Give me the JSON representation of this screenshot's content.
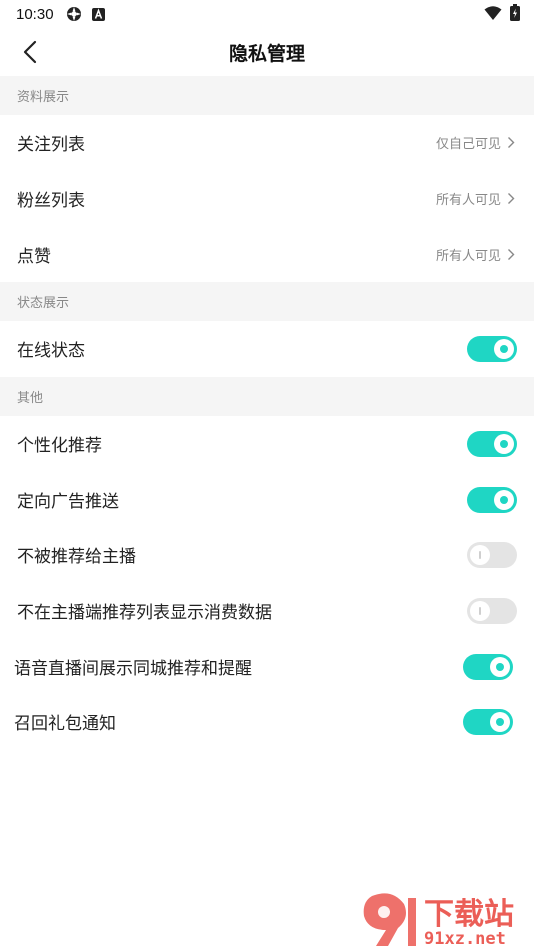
{
  "status_bar": {
    "time": "10:30"
  },
  "nav": {
    "title": "隐私管理"
  },
  "sections": [
    {
      "title": "资料展示"
    },
    {
      "title": "状态展示"
    },
    {
      "title": "其他"
    }
  ],
  "rows": {
    "follow_list": {
      "label": "关注列表",
      "value": "仅自己可见"
    },
    "fans_list": {
      "label": "粉丝列表",
      "value": "所有人可见"
    },
    "likes": {
      "label": "点赞",
      "value": "所有人可见"
    },
    "online_status": {
      "label": "在线状态",
      "enabled": true
    },
    "personalized_rec": {
      "label": "个性化推荐",
      "enabled": true
    },
    "targeted_ads": {
      "label": "定向广告推送",
      "enabled": true
    },
    "not_recommended_to_host": {
      "label": "不被推荐给主播",
      "enabled": false
    },
    "hide_consumption": {
      "label": "不在主播端推荐列表显示消费数据",
      "enabled": false
    },
    "voice_live_rec": {
      "label": "语音直播间展示同城推荐和提醒",
      "enabled": true
    },
    "recall_gift": {
      "label": "召回礼包通知",
      "enabled": true
    }
  },
  "watermark": {
    "text": "下载站",
    "domain": "91xz.net"
  },
  "colors": {
    "accent": "#1fd6c4",
    "toggle_off": "#e4e4e4",
    "section_bg": "#f5f5f5"
  }
}
